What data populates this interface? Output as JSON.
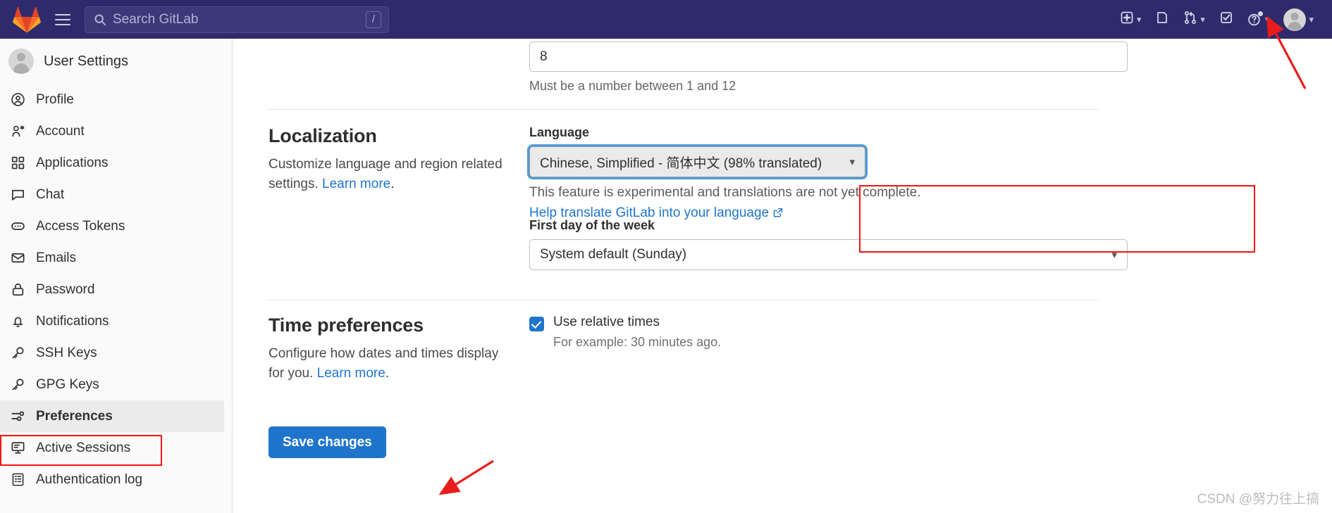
{
  "navbar": {
    "logo_icon": "gitlab-logo-icon",
    "menu_icon": "hamburger-menu-icon",
    "search": {
      "icon": "search-icon",
      "placeholder": "Search GitLab",
      "shortcut": "/"
    },
    "items": [
      {
        "icon": "plus-square-icon",
        "has_chevron": true
      },
      {
        "icon": "issues-icon",
        "has_chevron": false
      },
      {
        "icon": "merge-request-icon",
        "has_chevron": true
      },
      {
        "icon": "todos-done-icon",
        "has_chevron": false
      },
      {
        "icon": "help-question-icon",
        "has_chevron": true
      },
      {
        "icon": "user-avatar-icon",
        "has_chevron": true
      }
    ],
    "background": "#2f2a6b"
  },
  "sidebar": {
    "title": "User Settings",
    "avatar_icon": "user-avatar-icon",
    "items": [
      {
        "label": "Profile",
        "icon": "profile-user-circle-icon",
        "active": false
      },
      {
        "label": "Account",
        "icon": "account-user-gear-icon",
        "active": false
      },
      {
        "label": "Applications",
        "icon": "applications-grid-icon",
        "active": false
      },
      {
        "label": "Chat",
        "icon": "chat-bubble-icon",
        "active": false
      },
      {
        "label": "Access Tokens",
        "icon": "access-token-icon",
        "active": false
      },
      {
        "label": "Emails",
        "icon": "envelope-icon",
        "active": false
      },
      {
        "label": "Password",
        "icon": "lock-icon",
        "active": false
      },
      {
        "label": "Notifications",
        "icon": "bell-icon",
        "active": false
      },
      {
        "label": "SSH Keys",
        "icon": "key-icon",
        "active": false
      },
      {
        "label": "GPG Keys",
        "icon": "key-icon",
        "active": false
      },
      {
        "label": "Preferences",
        "icon": "preferences-sliders-icon",
        "active": true
      },
      {
        "label": "Active Sessions",
        "icon": "monitor-icon",
        "active": false
      },
      {
        "label": "Authentication log",
        "icon": "log-list-icon",
        "active": false
      }
    ]
  },
  "main": {
    "top_field": {
      "value": "8",
      "help": "Must be a number between 1 and 12"
    },
    "localization": {
      "title": "Localization",
      "description_prefix": "Customize language and region related settings. ",
      "learn_more": "Learn more",
      "description_suffix": ".",
      "language": {
        "label": "Language",
        "selected": "Chinese, Simplified - 简体中文 (98% translated)",
        "chevron_icon": "chevron-down-icon",
        "note": "This feature is experimental and translations are not yet complete.",
        "translate_link": "Help translate GitLab into your language",
        "external_link_icon": "external-link-icon"
      },
      "first_day": {
        "label": "First day of the week",
        "selected": "System default (Sunday)",
        "chevron_icon": "chevron-down-icon"
      }
    },
    "time_preferences": {
      "title": "Time preferences",
      "description_prefix": "Configure how dates and times display for you. ",
      "learn_more": "Learn more",
      "description_suffix": ".",
      "relative_times": {
        "label": "Use relative times",
        "checked": true,
        "sub": "For example: 30 minutes ago."
      }
    },
    "save_button": "Save changes"
  },
  "annotations": {
    "language_box_color": "#f41414",
    "preferences_box_color": "#f41414",
    "arrow_color": "#e81c1c"
  },
  "watermark": "CSDN @努力往上搞",
  "colors": {
    "navbar_bg": "#2f2a6b",
    "accent_blue": "#1f75cb",
    "link_blue": "#1f75cb",
    "sidebar_bg": "#fafafa"
  }
}
